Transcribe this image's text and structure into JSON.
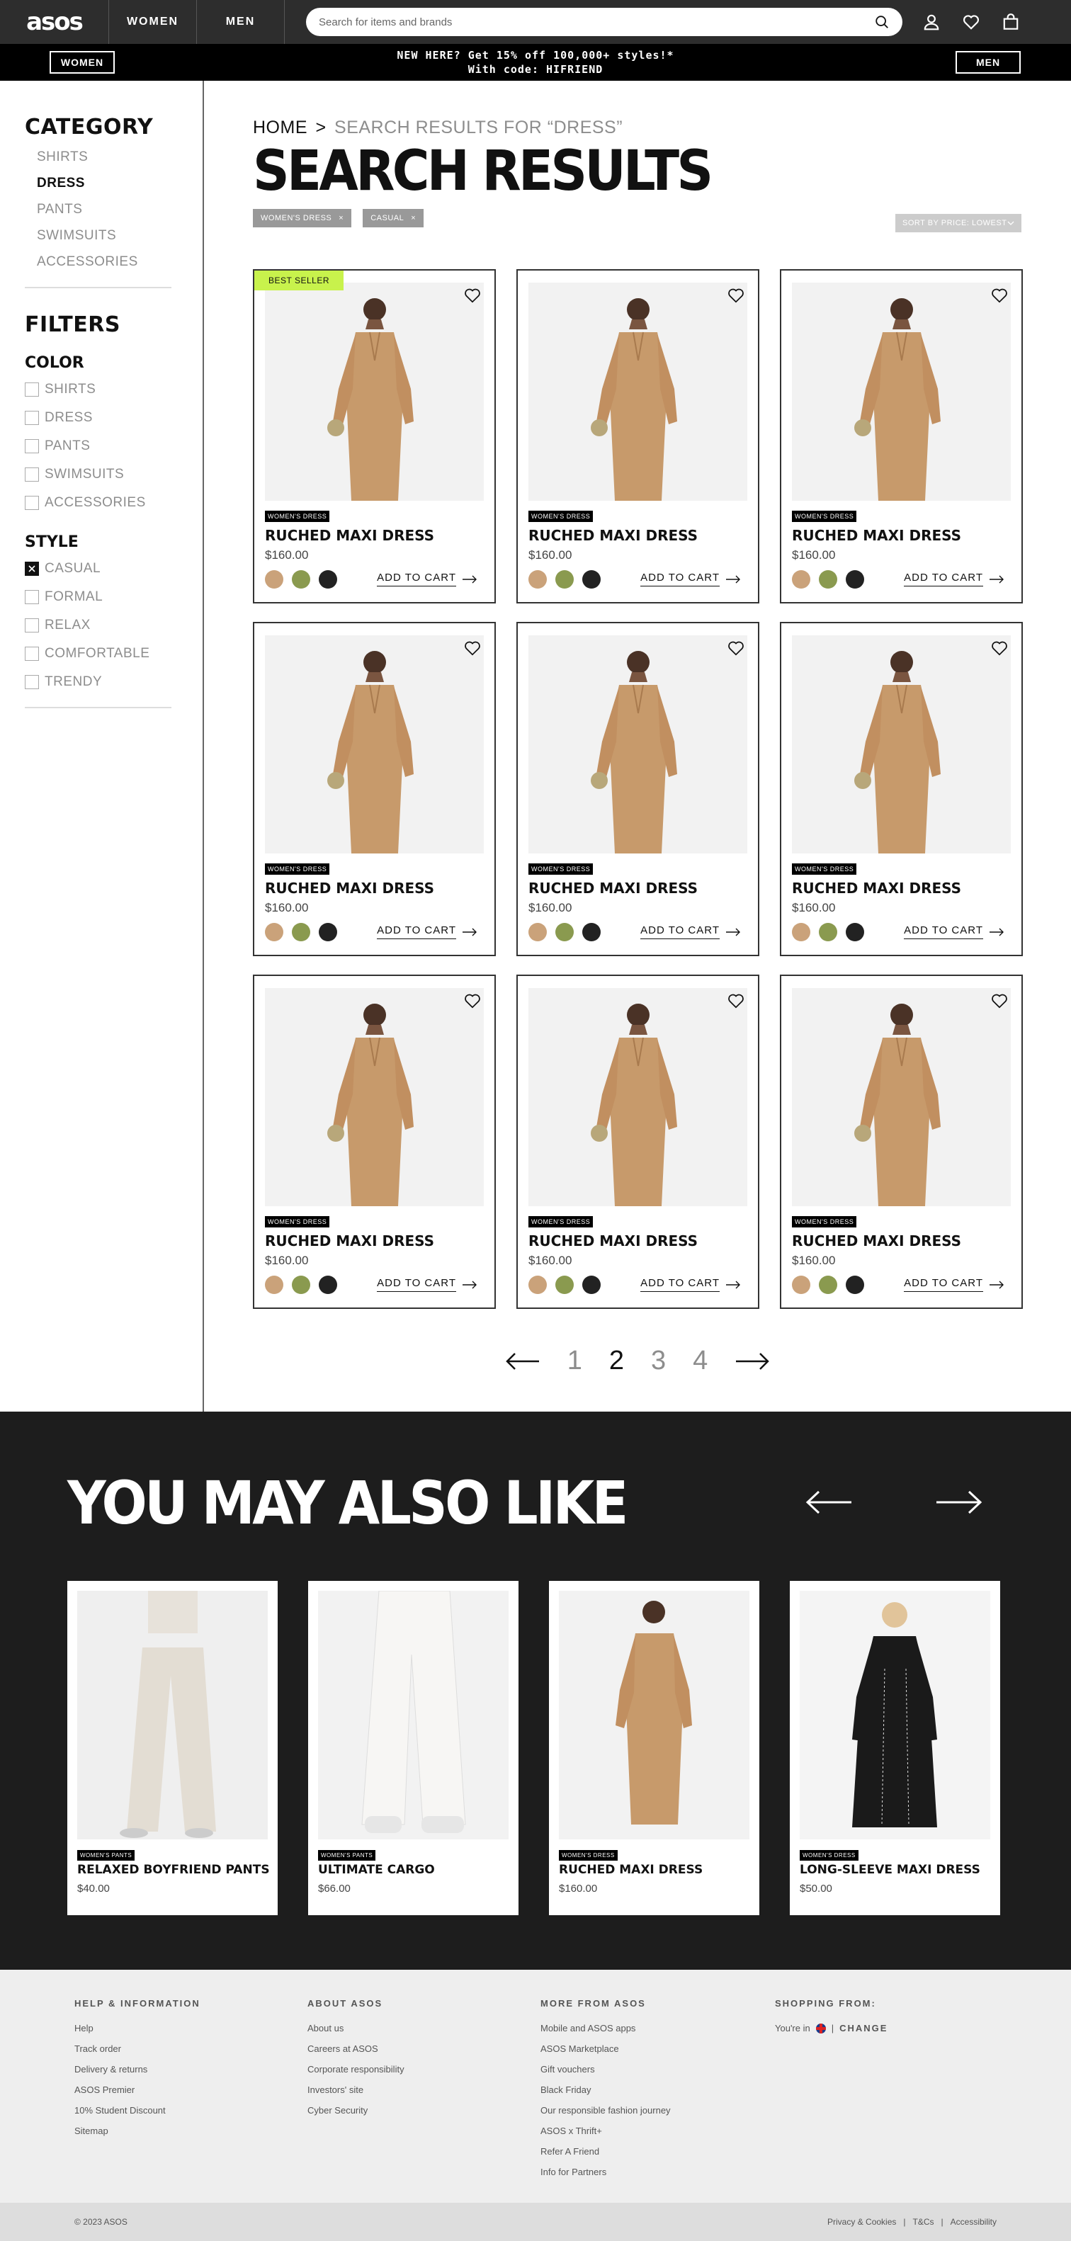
{
  "nav": {
    "logo": "asos",
    "tabs": [
      "WOMEN",
      "MEN"
    ],
    "search_placeholder": "Search for items and brands",
    "icons": [
      "search-icon",
      "account-icon",
      "heart-icon",
      "bag-icon"
    ]
  },
  "promo": {
    "left_button": "WOMEN",
    "right_button": "MEN",
    "line1": "NEW HERE? Get 15% off 100,000+ styles!*",
    "line2": "With code: HIFRIEND"
  },
  "sidebar": {
    "category_heading": "CATEGORY",
    "categories": [
      {
        "label": "SHIRTS",
        "active": false
      },
      {
        "label": "DRESS",
        "active": true
      },
      {
        "label": "PANTS",
        "active": false
      },
      {
        "label": "SWIMSUITS",
        "active": false
      },
      {
        "label": "ACCESSORIES",
        "active": false
      }
    ],
    "filters_heading": "FILTERS",
    "color_heading": "COLOR",
    "color_options": [
      {
        "label": "SHIRTS",
        "checked": false
      },
      {
        "label": "DRESS",
        "checked": false
      },
      {
        "label": "PANTS",
        "checked": false
      },
      {
        "label": "SWIMSUITS",
        "checked": false
      },
      {
        "label": "ACCESSORIES",
        "checked": false
      }
    ],
    "style_heading": "STYLE",
    "style_options": [
      {
        "label": "CASUAL",
        "checked": true
      },
      {
        "label": "FORMAL",
        "checked": false
      },
      {
        "label": "RELAX",
        "checked": false
      },
      {
        "label": "COMFORTABLE",
        "checked": false
      },
      {
        "label": "TRENDY",
        "checked": false
      }
    ]
  },
  "content": {
    "breadcrumb_home": "HOME",
    "breadcrumb_sep": ">",
    "breadcrumb_rest": "SEARCH RESULTS FOR “DRESS”",
    "title": "SEARCH RESULTS",
    "chips": [
      "WOMEN'S DRESS",
      "CASUAL"
    ],
    "sort_label": "SORT BY PRICE: LOWEST",
    "badge": "BEST SELLER",
    "products": [
      {
        "tag": "WOMEN'S DRESS",
        "name": "RUCHED MAXI DRESS",
        "price": "$160.00",
        "best_seller": true
      },
      {
        "tag": "WOMEN'S DRESS",
        "name": "RUCHED MAXI DRESS",
        "price": "$160.00",
        "best_seller": false
      },
      {
        "tag": "WOMEN'S DRESS",
        "name": "RUCHED MAXI DRESS",
        "price": "$160.00",
        "best_seller": false
      },
      {
        "tag": "WOMEN'S DRESS",
        "name": "RUCHED MAXI DRESS",
        "price": "$160.00",
        "best_seller": false
      },
      {
        "tag": "WOMEN'S DRESS",
        "name": "RUCHED MAXI DRESS",
        "price": "$160.00",
        "best_seller": false
      },
      {
        "tag": "WOMEN'S DRESS",
        "name": "RUCHED MAXI DRESS",
        "price": "$160.00",
        "best_seller": false
      },
      {
        "tag": "WOMEN'S DRESS",
        "name": "RUCHED MAXI DRESS",
        "price": "$160.00",
        "best_seller": false
      },
      {
        "tag": "WOMEN'S DRESS",
        "name": "RUCHED MAXI DRESS",
        "price": "$160.00",
        "best_seller": false
      },
      {
        "tag": "WOMEN'S DRESS",
        "name": "RUCHED MAXI DRESS",
        "price": "$160.00",
        "best_seller": false
      }
    ],
    "swatch_colors": [
      "#caa27a",
      "#8a9a4f",
      "#222222"
    ],
    "add_to_cart": "ADD TO CART",
    "pagination": {
      "pages": [
        "1",
        "2",
        "3",
        "4"
      ],
      "current": "2"
    }
  },
  "also_like": {
    "title": "YOU MAY ALSO LIKE",
    "items": [
      {
        "tag": "WOMEN'S PANTS",
        "name": "RELAXED BOYFRIEND PANTS",
        "price": "$40.00"
      },
      {
        "tag": "WOMEN'S PANTS",
        "name": "ULTIMATE CARGO",
        "price": "$66.00"
      },
      {
        "tag": "WOMEN'S DRESS",
        "name": "RUCHED MAXI DRESS",
        "price": "$160.00"
      },
      {
        "tag": "WOMEN'S DRESS",
        "name": "LONG-SLEEVE MAXI DRESS",
        "price": "$50.00"
      }
    ]
  },
  "footer": {
    "columns": [
      {
        "heading": "HELP & INFORMATION",
        "links": [
          "Help",
          "Track order",
          "Delivery & returns",
          "ASOS Premier",
          "10% Student Discount",
          "Sitemap"
        ]
      },
      {
        "heading": "ABOUT ASOS",
        "links": [
          "About us",
          "Careers at ASOS",
          "Corporate responsibility",
          "Investors' site",
          "Cyber Security"
        ]
      },
      {
        "heading": "MORE FROM ASOS",
        "links": [
          "Mobile and ASOS apps",
          "ASOS Marketplace",
          "Gift vouchers",
          "Black Friday",
          "Our responsible fashion journey",
          "ASOS x Thrift+",
          "Refer A Friend",
          "Info for Partners"
        ]
      }
    ],
    "shopping_heading": "SHOPPING FROM:",
    "youre_in": "You're in",
    "change": "CHANGE",
    "copyright": "© 2023 ASOS",
    "legal_links": [
      "Privacy & Cookies",
      "T&Cs",
      "Accessibility"
    ]
  }
}
